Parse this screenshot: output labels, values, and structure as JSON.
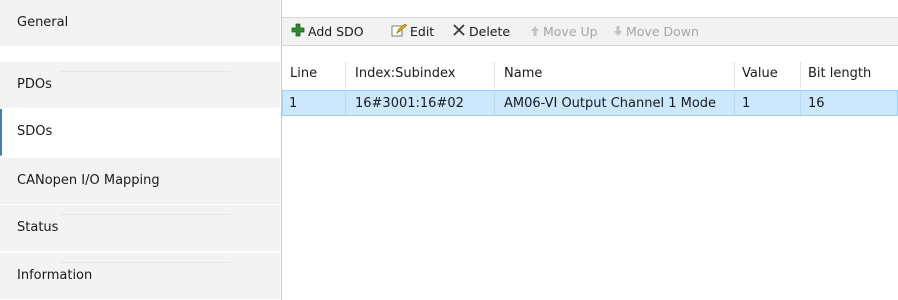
{
  "tabs": [
    {
      "label": "General"
    },
    {
      "label": "PDOs"
    },
    {
      "label": "SDOs"
    },
    {
      "label": "CANopen I/O Mapping"
    },
    {
      "label": "Status"
    },
    {
      "label": "Information"
    }
  ],
  "selected_tab": "SDOs",
  "toolbar": {
    "add_sdo": "Add SDO",
    "edit": "Edit",
    "delete": "Delete",
    "move_up": "Move Up",
    "move_down": "Move Down"
  },
  "table": {
    "columns": [
      "Line",
      "Index:Subindex",
      "Name",
      "Value",
      "Bit length"
    ],
    "rows": [
      [
        "1",
        "16#3001:16#02",
        "AM06-VI Output Channel 1 Mode",
        "1",
        "16"
      ]
    ]
  },
  "colors": {
    "selection_bg": "#cce8ff",
    "selection_border": "#99d1ff",
    "add_icon": "#2e8b2e",
    "delete_icon": "#333333"
  }
}
